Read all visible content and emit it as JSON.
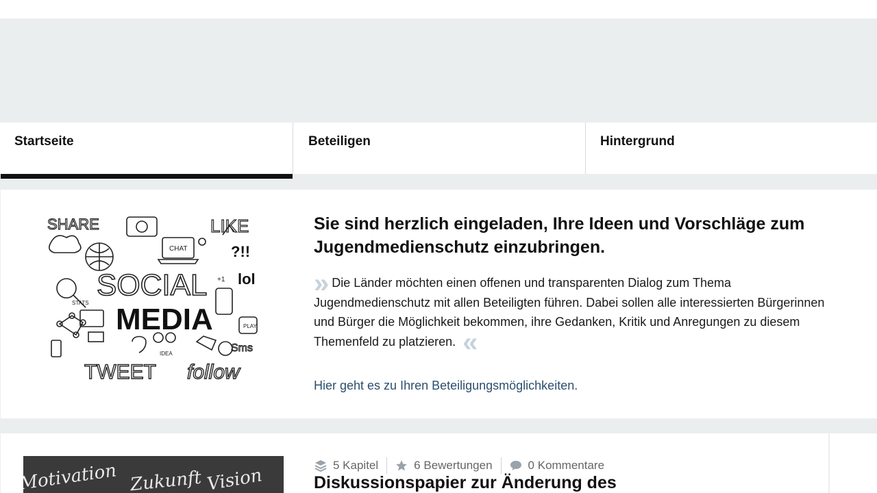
{
  "nav": {
    "tabs": [
      {
        "label": "Startseite",
        "active": true
      },
      {
        "label": "Beteiligen",
        "active": false
      },
      {
        "label": "Hintergrund",
        "active": false
      }
    ]
  },
  "hero": {
    "image": {
      "name": "social-media-doodle",
      "texts": [
        "SHARE",
        "LIKE",
        "CHAT",
        "SOCIAL",
        "MEDIA",
        "STATS",
        "PLAY",
        "+1",
        "lol",
        "?!!",
        "IDEA",
        "TWEET",
        "follow",
        "Sms"
      ]
    },
    "title": "Sie sind herzlich eingeladen, Ihre Ideen und Vorschläge zum Jugendmedienschutz einzubringen.",
    "quote": "Die Länder möchten einen offenen und transparenten Dialog zum Thema Jugendmedienschutz mit allen Beteiligten führen. Dabei sollen alle interessierten Bürgerinnen und Bürger die Möglichkeit bekommen, ihre Gedanken, Kritik und Anregungen zu diesem Themenfeld zu platzieren.",
    "quote_open": "»",
    "quote_close": "«",
    "link": "Hier geht es zu Ihren Beteiligungsmöglichkeiten."
  },
  "card": {
    "image_words": [
      "Motivation",
      "Zukunft",
      "Vision"
    ],
    "meta": [
      {
        "icon": "layers-icon",
        "text": "5 Kapitel"
      },
      {
        "icon": "star-icon",
        "text": "6 Bewertungen"
      },
      {
        "icon": "comment-icon",
        "text": "0 Kommentare"
      }
    ],
    "title": "Diskussionspapier zur Änderung des"
  },
  "colors": {
    "background": "#ebeeef",
    "link": "#2b4f6e",
    "quote_mark": "#c7d2dc"
  }
}
